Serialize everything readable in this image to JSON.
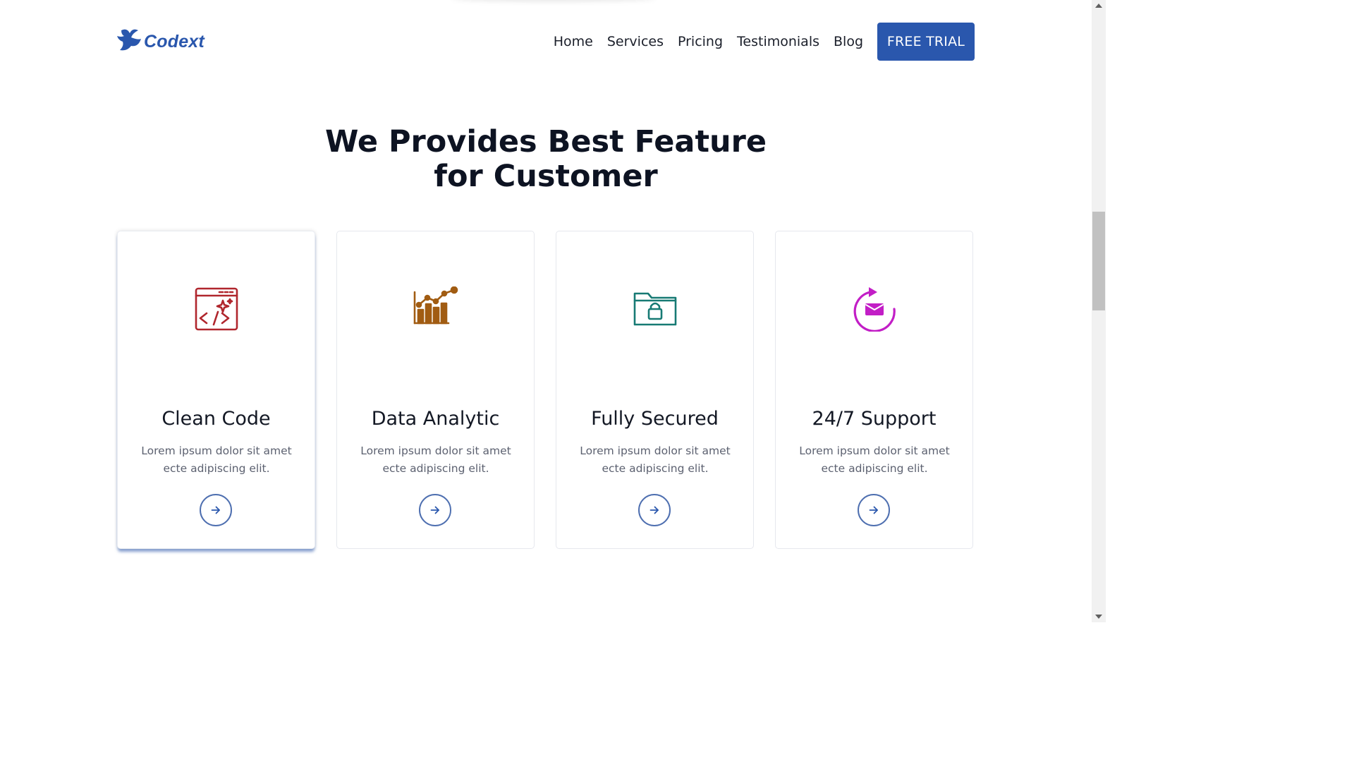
{
  "brand": {
    "name": "Codext",
    "color": "#2a57ad"
  },
  "nav": {
    "links": [
      "Home",
      "Services",
      "Pricing",
      "Testimonials",
      "Blog"
    ],
    "cta": "FREE TRIAL"
  },
  "hero": {
    "title_line1": "We Provides Best Feature",
    "title_line2": "for Customer"
  },
  "features": [
    {
      "title": "Clean Code",
      "desc_line1": "Lorem ipsum dolor sit amet",
      "desc_line2": "ecte adipiscing elit.",
      "icon": "code-window-icon",
      "color": "#b0262d"
    },
    {
      "title": "Data Analytic",
      "desc_line1": "Lorem ipsum dolor sit amet",
      "desc_line2": "ecte adipiscing elit.",
      "icon": "bar-chart-icon",
      "color": "#a15c12"
    },
    {
      "title": "Fully Secured",
      "desc_line1": "Lorem ipsum dolor sit amet",
      "desc_line2": "ecte adipiscing elit.",
      "icon": "locked-folder-icon",
      "color": "#177a74"
    },
    {
      "title": "24/7 Support",
      "desc_line1": "Lorem ipsum dolor sit amet",
      "desc_line2": "ecte adipiscing elit.",
      "icon": "mail-refresh-icon",
      "color": "#c21ec6"
    }
  ],
  "arrow_icon": "arrow-right-icon"
}
